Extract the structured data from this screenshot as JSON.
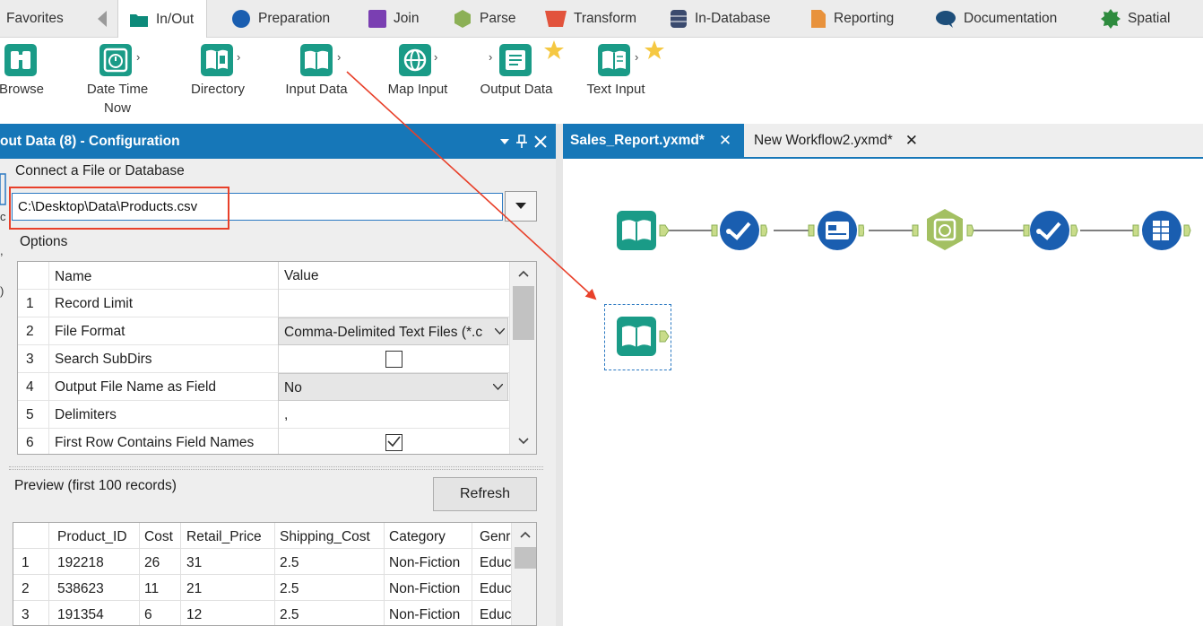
{
  "categories": [
    {
      "label": "Favorites",
      "color": "",
      "icon": "none"
    },
    {
      "label": "In/Out",
      "color": "#0d8a7a",
      "icon": "folder-icon",
      "active": true
    },
    {
      "label": "Preparation",
      "color": "#1a5eb0",
      "icon": "circle-icon"
    },
    {
      "label": "Join",
      "color": "#7a3fb2",
      "icon": "square-icon"
    },
    {
      "label": "Parse",
      "color": "#8cb056",
      "icon": "hexagon-icon"
    },
    {
      "label": "Transform",
      "color": "#e2533c",
      "icon": "trapezoid-icon"
    },
    {
      "label": "In-Database",
      "color": "#3a4a6e",
      "icon": "database-icon"
    },
    {
      "label": "Reporting",
      "color": "#e8923c",
      "icon": "document-icon"
    },
    {
      "label": "Documentation",
      "color": "#1d4e7a",
      "icon": "speech-bubble-icon"
    },
    {
      "label": "Spatial",
      "color": "#2e8b3e",
      "icon": "gear-icon"
    }
  ],
  "tools": [
    {
      "label": "Browse",
      "icon": "binoculars-icon"
    },
    {
      "label": "Date Time\nNow",
      "icon": "clock-icon"
    },
    {
      "label": "Directory",
      "icon": "directory-icon"
    },
    {
      "label": "Input Data",
      "icon": "book-icon"
    },
    {
      "label": "Map Input",
      "icon": "globe-icon"
    },
    {
      "label": "Output Data",
      "icon": "output-icon",
      "starred": true
    },
    {
      "label": "Text Input",
      "icon": "text-book-icon",
      "starred": true
    }
  ],
  "panel": {
    "title": "out Data (8) - Configuration",
    "connect_label": "Connect a File or Database",
    "path_value": "C:\\Desktop\\Data\\Products.csv",
    "options_label": "Options",
    "col_name": "Name",
    "col_value": "Value",
    "options": [
      {
        "num": "1",
        "name": "Record Limit",
        "value": "",
        "kind": "text"
      },
      {
        "num": "2",
        "name": "File Format",
        "value": "Comma-Delimited Text Files (*.c",
        "kind": "select"
      },
      {
        "num": "3",
        "name": "Search SubDirs",
        "value": "",
        "kind": "checkbox",
        "checked": false
      },
      {
        "num": "4",
        "name": "Output File Name as Field",
        "value": "No",
        "kind": "select"
      },
      {
        "num": "5",
        "name": "Delimiters",
        "value": ",",
        "kind": "text"
      },
      {
        "num": "6",
        "name": "First Row Contains Field Names",
        "value": "",
        "kind": "checkbox",
        "checked": true
      }
    ],
    "preview_label": "Preview (first 100 records)",
    "refresh_label": "Refresh",
    "preview_columns": [
      "",
      "Product_ID",
      "Cost",
      "Retail_Price",
      "Shipping_Cost",
      "Category",
      "Genr"
    ],
    "preview_rows": [
      [
        "1",
        "192218",
        "26",
        "31",
        "2.5",
        "Non-Fiction",
        "Educ"
      ],
      [
        "2",
        "538623",
        "11",
        "21",
        "2.5",
        "Non-Fiction",
        "Educ"
      ],
      [
        "3",
        "191354",
        "6",
        "12",
        "2.5",
        "Non-Fiction",
        "Educ"
      ]
    ]
  },
  "canvas_tabs": [
    {
      "label": "Sales_Report.yxmd*",
      "active": true
    },
    {
      "label": "New Workflow2.yxmd*",
      "active": false
    }
  ],
  "colors": {
    "accent": "#1677b8",
    "annotation_red": "#e8402a",
    "inout_teal": "#1a9b87",
    "prep_blue": "#1a5eb0",
    "parse_green": "#8cb056"
  }
}
